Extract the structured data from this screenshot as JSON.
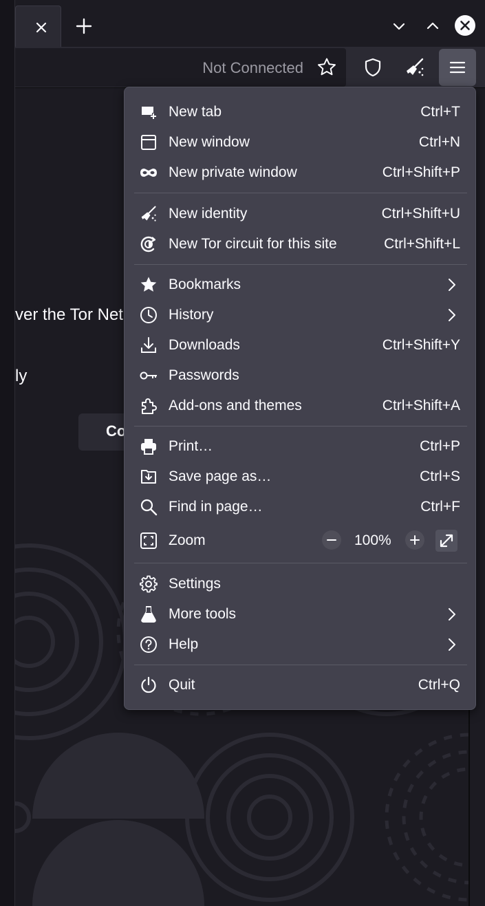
{
  "tabstrip": {
    "tab_close_icon": "close-icon",
    "new_tab_icon": "plus-icon",
    "window_controls": [
      "chevron-down-icon",
      "chevron-up-icon",
      "close-circle-icon"
    ]
  },
  "navbar": {
    "connection_status": "Not Connected",
    "buttons": [
      "star-icon",
      "shield-icon",
      "broom-icon",
      "hamburger-menu-icon"
    ]
  },
  "page": {
    "text_fragments": [
      "ver the Tor Net",
      "ly",
      "Co"
    ]
  },
  "menu": {
    "groups": [
      [
        {
          "label": "New tab",
          "shortcut": "Ctrl+T",
          "icon": "new-tab-icon"
        },
        {
          "label": "New window",
          "shortcut": "Ctrl+N",
          "icon": "window-icon"
        },
        {
          "label": "New private window",
          "shortcut": "Ctrl+Shift+P",
          "icon": "private-mask-icon"
        }
      ],
      [
        {
          "label": "New identity",
          "shortcut": "Ctrl+Shift+U",
          "icon": "broom-icon"
        },
        {
          "label": "New Tor circuit for this site",
          "shortcut": "Ctrl+Shift+L",
          "icon": "tor-circuit-icon"
        }
      ],
      [
        {
          "label": "Bookmarks",
          "shortcut": "",
          "icon": "star-filled-icon",
          "submenu": true
        },
        {
          "label": "History",
          "shortcut": "",
          "icon": "clock-icon",
          "submenu": true
        },
        {
          "label": "Downloads",
          "shortcut": "Ctrl+Shift+Y",
          "icon": "download-icon"
        },
        {
          "label": "Passwords",
          "shortcut": "",
          "icon": "key-icon"
        },
        {
          "label": "Add-ons and themes",
          "shortcut": "Ctrl+Shift+A",
          "icon": "puzzle-icon"
        }
      ],
      [
        {
          "label": "Print…",
          "shortcut": "Ctrl+P",
          "icon": "printer-icon"
        },
        {
          "label": "Save page as…",
          "shortcut": "Ctrl+S",
          "icon": "save-page-icon"
        },
        {
          "label": "Find in page…",
          "shortcut": "Ctrl+F",
          "icon": "search-icon"
        }
      ]
    ],
    "zoom": {
      "label": "Zoom",
      "value": "100%",
      "minus": "−",
      "plus": "+",
      "icon": "zoom-frame-icon"
    },
    "tools_group": [
      {
        "label": "Settings",
        "shortcut": "",
        "icon": "gear-icon"
      },
      {
        "label": "More tools",
        "shortcut": "",
        "icon": "flask-icon",
        "submenu": true
      },
      {
        "label": "Help",
        "shortcut": "",
        "icon": "help-icon",
        "submenu": true
      }
    ],
    "quit": {
      "label": "Quit",
      "shortcut": "Ctrl+Q",
      "icon": "power-icon"
    }
  },
  "colors": {
    "background": "#1c1b22",
    "toolbar": "#2b2a33",
    "menu": "#42414d",
    "menu_separator": "#5b5b66",
    "active_button": "#52525e"
  }
}
